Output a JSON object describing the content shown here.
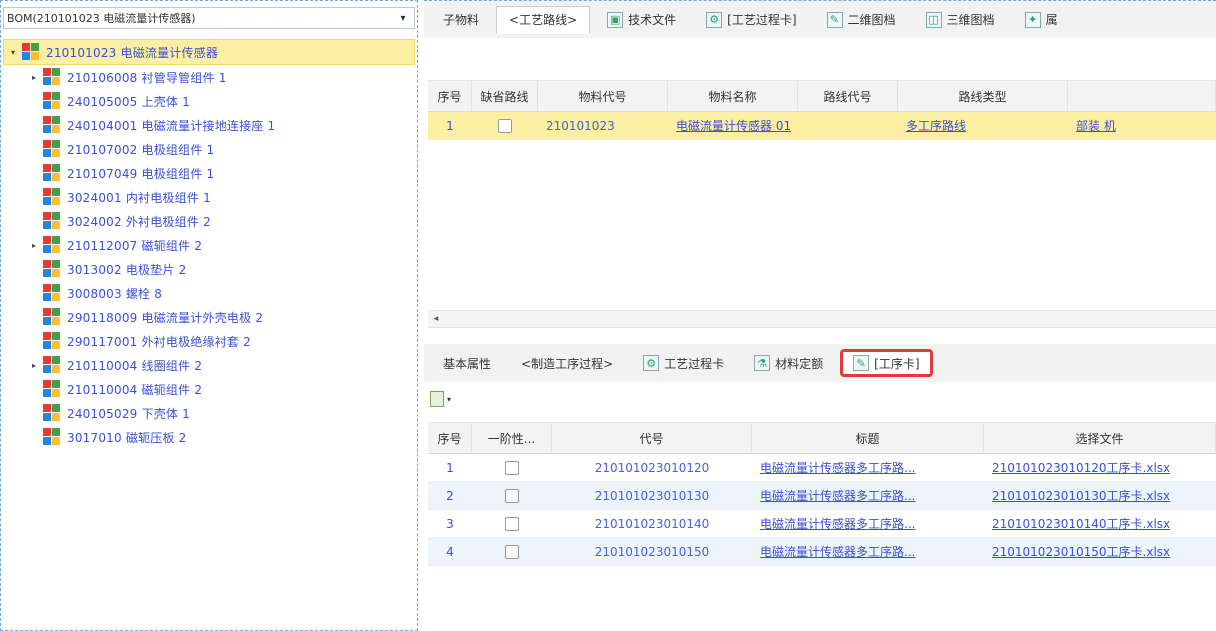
{
  "left": {
    "bom_select": {
      "value": "BOM(210101023 电磁流量计传感器)",
      "arrow": "▾"
    },
    "tree": [
      {
        "label": "210101023 电磁流量计传感器",
        "toggle": "▾",
        "root": true
      },
      {
        "label": "210106008 衬管导管组件 1",
        "toggle": "▸"
      },
      {
        "label": "240105005 上壳体 1",
        "toggle": ""
      },
      {
        "label": "240104001 电磁流量计接地连接座 1",
        "toggle": ""
      },
      {
        "label": "210107002 电极组组件 1",
        "toggle": ""
      },
      {
        "label": "210107049 电极组组件 1",
        "toggle": ""
      },
      {
        "label": "3024001 内衬电极组件 1",
        "toggle": ""
      },
      {
        "label": "3024002 外衬电极组件 2",
        "toggle": ""
      },
      {
        "label": "210112007 磁轭组件 2",
        "toggle": "▸"
      },
      {
        "label": "3013002 电极垫片 2",
        "toggle": ""
      },
      {
        "label": "3008003 螺栓 8",
        "toggle": ""
      },
      {
        "label": "290118009 电磁流量计外壳电极 2",
        "toggle": ""
      },
      {
        "label": "290117001 外衬电极绝缘衬套 2",
        "toggle": ""
      },
      {
        "label": "210110004 线圈组件 2",
        "toggle": "▸"
      },
      {
        "label": "210110004 磁轭组件 2",
        "toggle": ""
      },
      {
        "label": "240105029 下壳体 1",
        "toggle": ""
      },
      {
        "label": "3017010 磁轭压板 2",
        "toggle": ""
      }
    ]
  },
  "top_tabs": [
    {
      "label": "子物料",
      "icon": "",
      "active": false
    },
    {
      "label": "<工艺路线>",
      "icon": "",
      "active": true
    },
    {
      "label": "技术文件",
      "icon": "▣",
      "active": false
    },
    {
      "label": "[工艺过程卡]",
      "icon": "⚙",
      "active": false
    },
    {
      "label": "二维图档",
      "icon": "✎",
      "active": false
    },
    {
      "label": "三维图档",
      "icon": "◫",
      "active": false
    },
    {
      "label": "属",
      "icon": "✦",
      "active": false
    }
  ],
  "upper_grid": {
    "headers": [
      "序号",
      "缺省路线",
      "物料代号",
      "物料名称",
      "路线代号",
      "路线类型",
      ""
    ],
    "rows": [
      {
        "seq": "1",
        "code": "210101023",
        "name": "电磁流量计传感器 01",
        "route_code": "",
        "route_type": "多工序路线",
        "extra": "部装 机"
      }
    ]
  },
  "scroll": {
    "left_arrow": "◂"
  },
  "bottom_tabs": [
    {
      "label": "基本属性",
      "icon": "",
      "active": false,
      "highlight": false
    },
    {
      "label": "<制造工序过程>",
      "icon": "",
      "active": false,
      "highlight": false
    },
    {
      "label": "工艺过程卡",
      "icon": "⚙",
      "active": false,
      "highlight": false
    },
    {
      "label": "材料定额",
      "icon": "⚗",
      "active": false,
      "highlight": false
    },
    {
      "label": "[工序卡]",
      "icon": "✎",
      "active": true,
      "highlight": true
    }
  ],
  "tools": {
    "caret": "▾"
  },
  "lower_grid": {
    "headers": [
      "序号",
      "一阶性...",
      "代号",
      "标题",
      "选择文件"
    ],
    "rows": [
      {
        "seq": "1",
        "code": "210101023010120",
        "title": "电磁流量计传感器多工序路...",
        "file": "210101023010120工序卡.xlsx"
      },
      {
        "seq": "2",
        "code": "210101023010130",
        "title": "电磁流量计传感器多工序路...",
        "file": "210101023010130工序卡.xlsx"
      },
      {
        "seq": "3",
        "code": "210101023010140",
        "title": "电磁流量计传感器多工序路...",
        "file": "210101023010140工序卡.xlsx"
      },
      {
        "seq": "4",
        "code": "210101023010150",
        "title": "电磁流量计传感器多工序路...",
        "file": "210101023010150工序卡.xlsx"
      }
    ]
  }
}
